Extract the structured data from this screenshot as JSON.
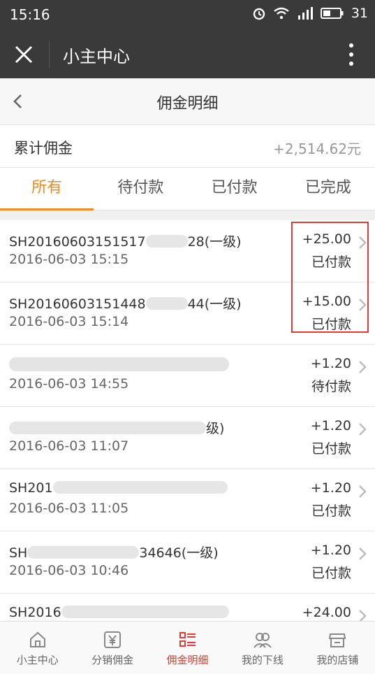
{
  "status_bar": {
    "time": "15:16",
    "battery": "31"
  },
  "app_bar": {
    "title": "小主中心"
  },
  "sub_header": {
    "title": "佣金明细"
  },
  "total": {
    "label": "累计佣金",
    "value": "+2,514.62元"
  },
  "tabs": [
    {
      "label": "所有",
      "active": true
    },
    {
      "label": "待付款",
      "active": false
    },
    {
      "label": "已付款",
      "active": false
    },
    {
      "label": "已完成",
      "active": false
    }
  ],
  "items": [
    {
      "order_prefix": "SH20160603151517",
      "order_suffix": "28(一级)",
      "date": "2016-06-03 15:15",
      "amount": "+25.00",
      "status": "已付款"
    },
    {
      "order_prefix": "SH20160603151448",
      "order_suffix": "44(一级)",
      "date": "2016-06-03 15:14",
      "amount": "+15.00",
      "status": "已付款"
    },
    {
      "order_prefix": "",
      "order_suffix": "",
      "date": "2016-06-03 14:55",
      "amount": "+1.20",
      "status": "待付款"
    },
    {
      "order_prefix": "",
      "order_suffix": "级)",
      "date": "2016-06-03 11:07",
      "amount": "+1.20",
      "status": "已付款"
    },
    {
      "order_prefix": "SH201",
      "order_suffix": "",
      "date": "2016-06-03 11:05",
      "amount": "+1.20",
      "status": "已付款"
    },
    {
      "order_prefix": "SH",
      "order_suffix": "34646(一级)",
      "date": "2016-06-03 10:46",
      "amount": "+1.20",
      "status": "已付款"
    },
    {
      "order_prefix": "SH2016",
      "order_suffix": "",
      "date": "",
      "amount": "+24.00",
      "status": ""
    }
  ],
  "bottom_nav": [
    {
      "label": "小主中心",
      "icon": "home-icon",
      "active": false
    },
    {
      "label": "分销佣金",
      "icon": "yen-icon",
      "active": false
    },
    {
      "label": "佣金明细",
      "icon": "list-icon",
      "active": true
    },
    {
      "label": "我的下线",
      "icon": "people-icon",
      "active": false
    },
    {
      "label": "我的店铺",
      "icon": "store-icon",
      "active": false
    }
  ],
  "colors": {
    "accent": "#f08a24",
    "nav_active": "#e53935",
    "highlight": "#e53935"
  }
}
